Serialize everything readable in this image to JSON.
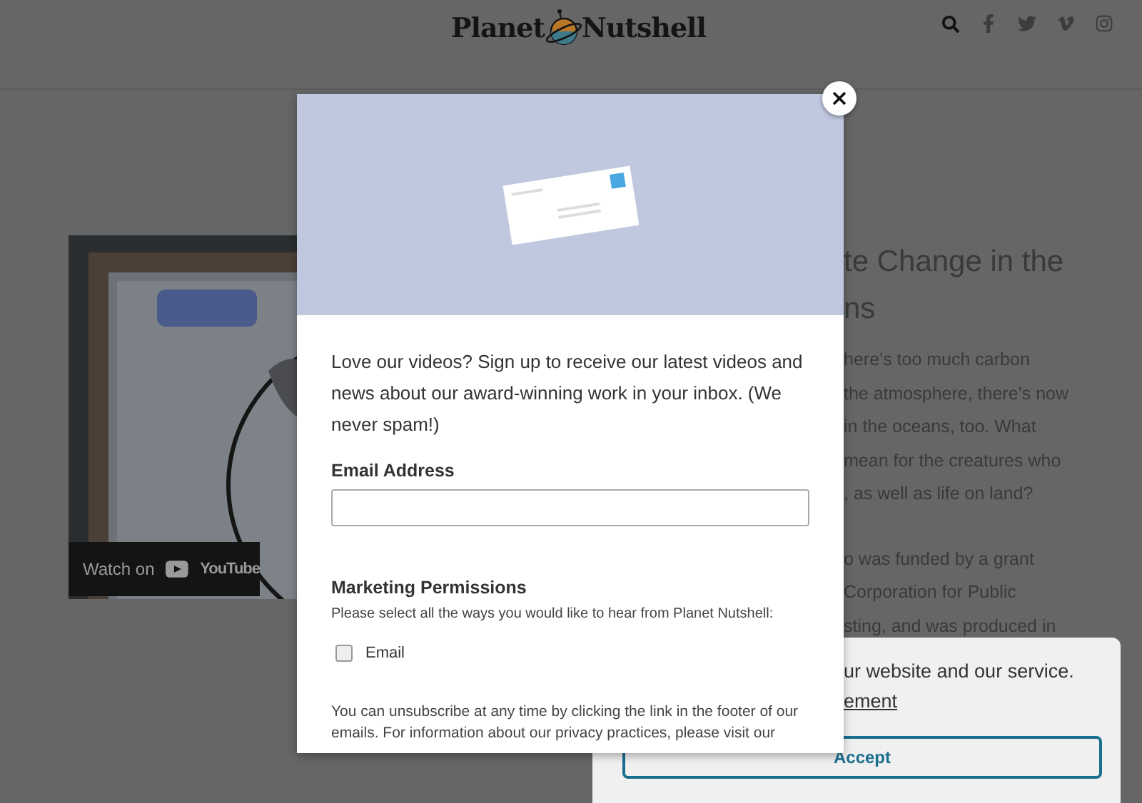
{
  "header": {
    "logo_left": "Planet",
    "logo_right": "Nutshell"
  },
  "video": {
    "watch_label": "Watch on",
    "brand": "YouTube"
  },
  "article": {
    "title_lines": [
      "te Change in the",
      "ns"
    ],
    "paragraph_lines": [
      "here’s too much carbon",
      "the atmosphere, there’s now",
      "in the oceans, too. What",
      "mean for the creatures who",
      ", as well as life on land?"
    ],
    "paragraph2_lines": [
      "o was funded by a grant",
      "Corporation for Public",
      "sting, and was produced in"
    ]
  },
  "modal": {
    "intro": "Love our videos? Sign up to receive our latest videos and news about our award-winning work in your inbox. (We never spam!)",
    "email_label": "Email Address",
    "permissions_title": "Marketing Permissions",
    "permissions_text": "Please select all the ways you would like to hear from Planet Nutshell:",
    "options": [
      {
        "label": "Email",
        "checked": false
      }
    ],
    "footer_text": "You can unsubscribe at any time by clicking the link in the footer of our emails. For information about our privacy practices, please visit our"
  },
  "cookie": {
    "text": "ur website and our service.",
    "link": "ement",
    "button": "Accept"
  }
}
